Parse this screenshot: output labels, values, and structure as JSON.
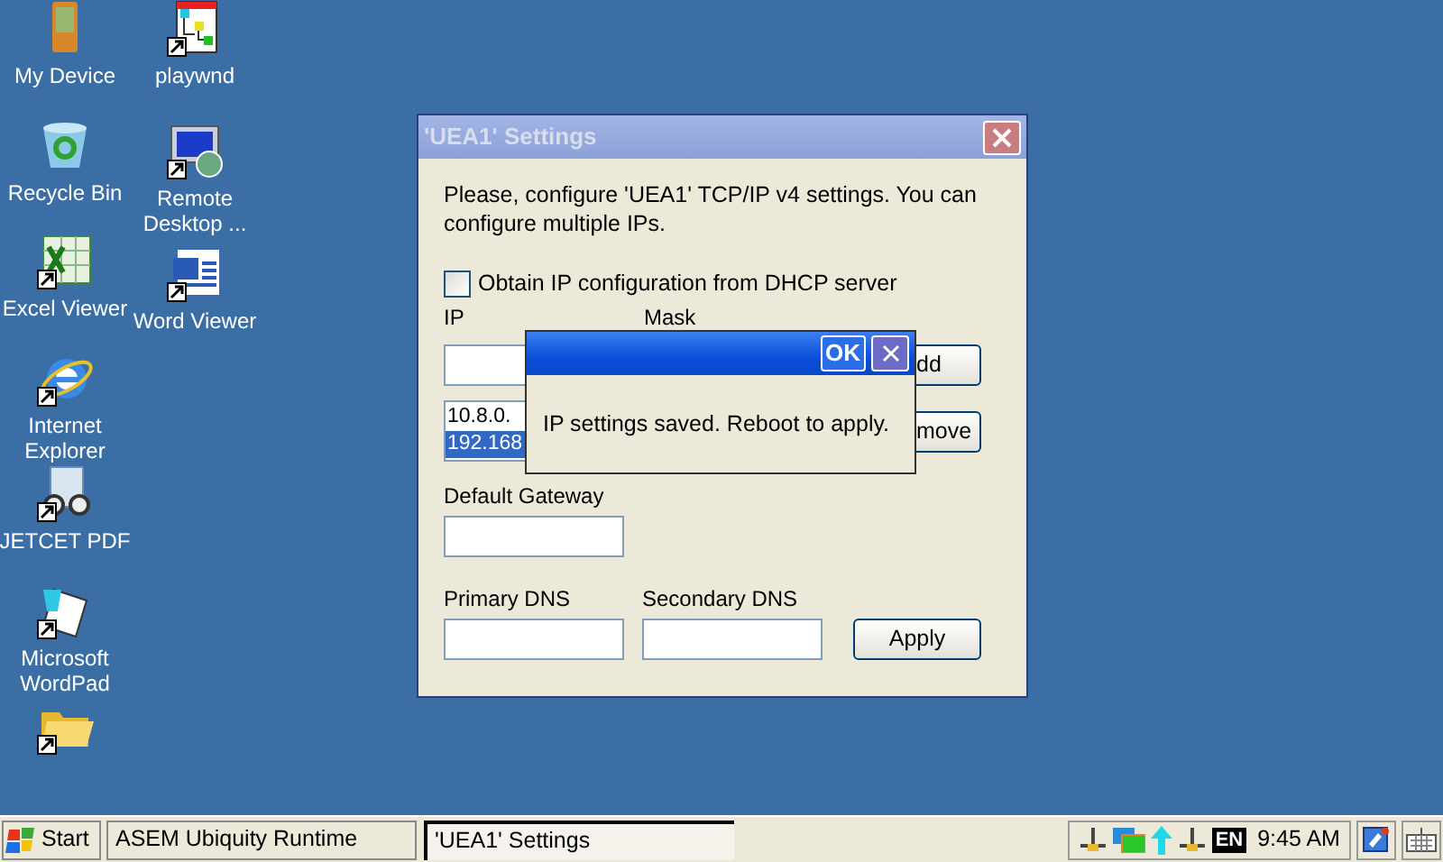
{
  "desktop": {
    "columns": [
      [
        {
          "label": "My Device",
          "kind": "device",
          "shortcut": false
        },
        {
          "label": "Recycle Bin",
          "kind": "recycle",
          "shortcut": false
        },
        {
          "label": "Excel Viewer",
          "kind": "excel",
          "shortcut": true
        },
        {
          "label": "Internet Explorer",
          "kind": "ie",
          "shortcut": true
        },
        {
          "label": "JETCET PDF",
          "kind": "pdf",
          "shortcut": true
        },
        {
          "label": "Microsoft WordPad",
          "kind": "wordpad",
          "shortcut": true
        },
        {
          "kind": "folder",
          "shortcut": true
        }
      ],
      [
        {
          "label": "playwnd",
          "kind": "diagram",
          "shortcut": true
        },
        {
          "label": "Remote Desktop ...",
          "kind": "remote",
          "shortcut": true
        },
        {
          "label": "Word Viewer",
          "kind": "word",
          "shortcut": true
        }
      ]
    ]
  },
  "window": {
    "title": "'UEA1' Settings",
    "description": "Please, configure 'UEA1' TCP/IP v4 settings. You can configure multiple IPs.",
    "dhcp": {
      "label": "Obtain IP configuration from DHCP server",
      "checked": false
    },
    "ip_label": "IP",
    "mask_label": "Mask",
    "add_button": "dd",
    "address_list": [
      {
        "text": "10.8.0.",
        "selected": false
      },
      {
        "text": "192.168",
        "selected": true
      }
    ],
    "remove_button": "move",
    "gateway_label": "Default Gateway",
    "primary_dns_label": "Primary DNS",
    "secondary_dns_label": "Secondary DNS",
    "apply_button": "Apply"
  },
  "message_box": {
    "ok_button": "OK",
    "message": "IP settings saved. Reboot to apply."
  },
  "taskbar": {
    "start": "Start",
    "tasks": [
      {
        "label": "ASEM Ubiquity Runtime",
        "selected": false
      },
      {
        "label": "'UEA1' Settings",
        "selected": true
      }
    ],
    "language": "EN",
    "clock": "9:45 AM"
  }
}
